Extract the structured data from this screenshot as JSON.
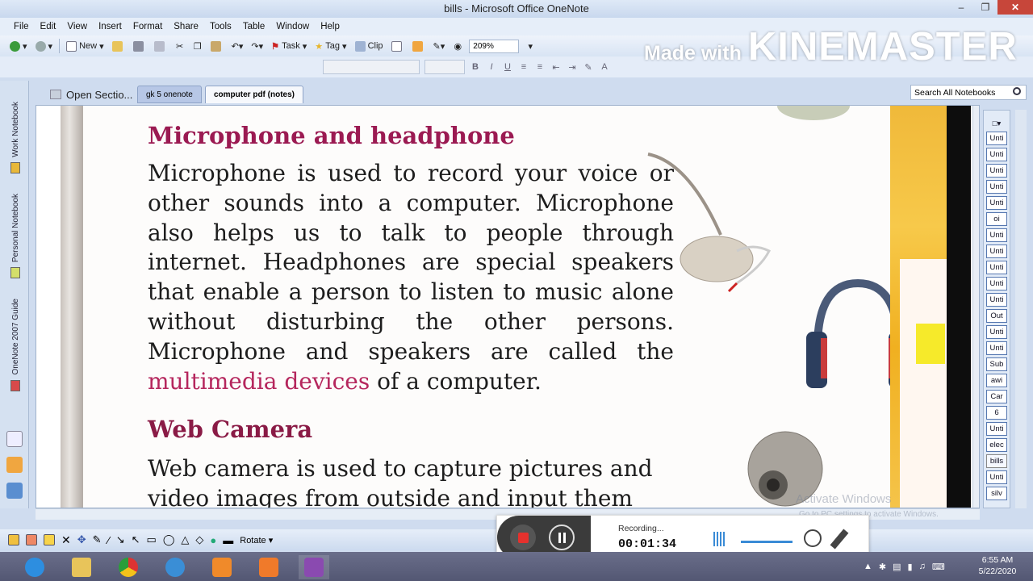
{
  "window": {
    "title": "bills - Microsoft Office OneNote"
  },
  "menu": [
    "File",
    "Edit",
    "View",
    "Insert",
    "Format",
    "Share",
    "Tools",
    "Table",
    "Window",
    "Help"
  ],
  "toolbar": {
    "new_label": "New",
    "task_label": "Task",
    "tag_label": "Tag",
    "clip_label": "Clip",
    "zoom": "209%"
  },
  "watermark": {
    "small": "Made with",
    "big": "KINEMASTER"
  },
  "notebooks": [
    "Work Notebook",
    "Personal Notebook",
    "OneNote 2007 Guide"
  ],
  "tabs": {
    "open_sections": "Open Sectio...",
    "gk": "gk 5 onenote",
    "computer": "computer pdf (notes)"
  },
  "search": {
    "placeholder": "Search All Notebooks"
  },
  "page": {
    "heading1": "Microphone and headphone",
    "para1_main": "Microphone  is used to record your voice or other sounds into a computer. Microphone also helps us to talk to people through internet. Headphones are special speakers that enable a person to listen to music alone without disturbing the other persons. Microphone and speakers are called the ",
    "para1_pink": "multimedia devices",
    "para1_tail": " of a computer.",
    "heading2": "Web Camera",
    "para2": "Web camera is used to capture pictures and video images from outside and input them"
  },
  "page_list": [
    "Unti",
    "Unti",
    "Unti",
    "Unti",
    "Unti",
    "oi",
    "Unti",
    "Unti",
    "Unti",
    "Unti",
    "Unti",
    "Out",
    "Unti",
    "Unti",
    "Sub",
    "awi",
    "Car",
    "6",
    "Unti",
    "elec",
    "bills",
    "Unti",
    "silv"
  ],
  "drawbar": {
    "rotate_label": "Rotate"
  },
  "recording": {
    "label": "Recording...",
    "time": "00:01:34"
  },
  "activation": {
    "line1": "Activate Windows",
    "line2": "Go to PC settings to activate Windows."
  },
  "clock": {
    "time": "6:55 AM",
    "date": "5/22/2020"
  },
  "colors": {
    "heading": "#9b1a52",
    "pink_text": "#b5265d",
    "accent_book": "#f0b93a"
  }
}
